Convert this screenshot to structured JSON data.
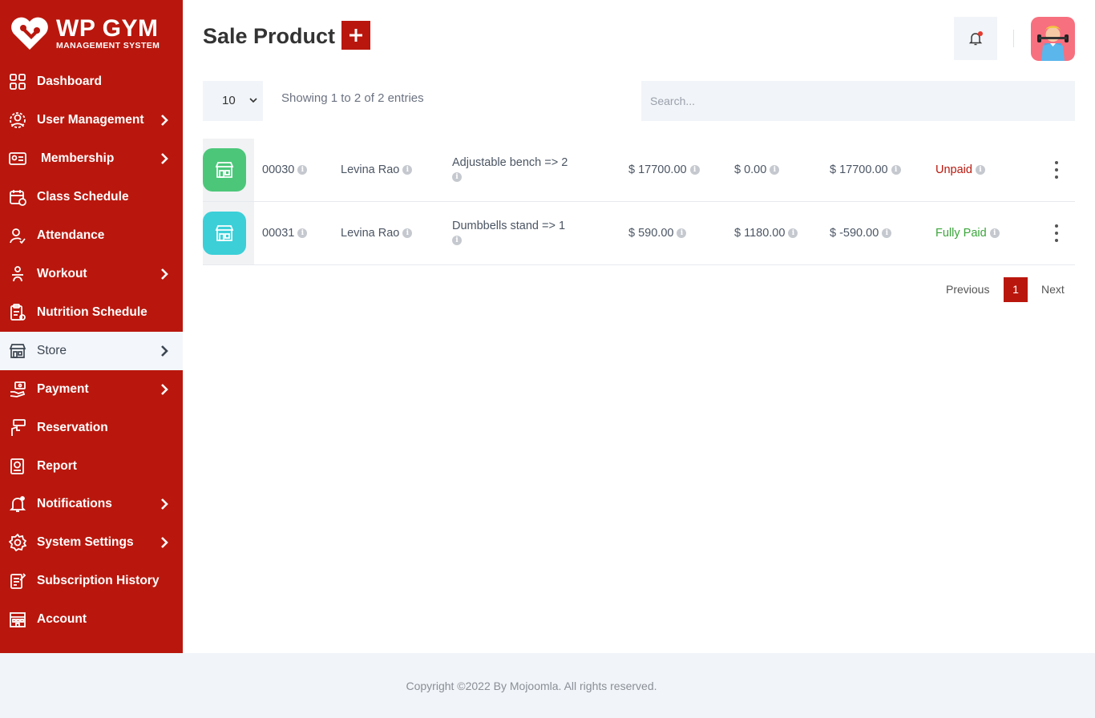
{
  "brand": {
    "title": "WP GYM",
    "subtitle": "MANAGEMENT SYSTEM"
  },
  "colors": {
    "primary": "#b9170d",
    "active_bg": "#f3f6fa",
    "unpaid": "#b9170d",
    "paid": "#3aa53a",
    "thumb_green": "#4cc77a",
    "thumb_teal": "#3ccfd8"
  },
  "sidebar": {
    "items": [
      {
        "label": "Dashboard",
        "icon": "dashboard-grid-icon",
        "has_chevron": false
      },
      {
        "label": "User Management",
        "icon": "users-gear-icon",
        "has_chevron": true
      },
      {
        "label": "Membership",
        "icon": "membership-card-icon",
        "has_chevron": true
      },
      {
        "label": "Class Schedule",
        "icon": "calendar-icon",
        "has_chevron": false
      },
      {
        "label": "Attendance",
        "icon": "user-check-icon",
        "has_chevron": false
      },
      {
        "label": "Workout",
        "icon": "workout-icon",
        "has_chevron": true
      },
      {
        "label": "Nutrition Schedule",
        "icon": "clipboard-icon",
        "has_chevron": false
      },
      {
        "label": "Store",
        "icon": "store-icon",
        "has_chevron": true,
        "active": true
      },
      {
        "label": "Payment",
        "icon": "payment-hand-icon",
        "has_chevron": true
      },
      {
        "label": "Reservation",
        "icon": "reservation-book-icon",
        "has_chevron": false
      },
      {
        "label": "Report",
        "icon": "report-icon",
        "has_chevron": false
      },
      {
        "label": "Notifications",
        "icon": "bell-icon",
        "has_chevron": true
      },
      {
        "label": "System Settings",
        "icon": "gear-icon",
        "has_chevron": true
      },
      {
        "label": "Subscription History",
        "icon": "history-doc-icon",
        "has_chevron": false
      },
      {
        "label": "Account",
        "icon": "account-building-icon",
        "has_chevron": false
      }
    ]
  },
  "header": {
    "title": "Sale Product",
    "add_label": "+"
  },
  "table": {
    "length_value": "10",
    "showing": "Showing 1 to 2 of 2 entries",
    "search_placeholder": "Search...",
    "rows": [
      {
        "id": "00030",
        "member": "Levina Rao",
        "product": "Adjustable bench => 2",
        "amount": "$ 17700.00",
        "paid": "$ 0.00",
        "due": "$ 17700.00",
        "status": "Unpaid"
      },
      {
        "id": "00031",
        "member": "Levina Rao",
        "product": "Dumbbells stand => 1",
        "amount": "$ 590.00",
        "paid": "$ 1180.00",
        "due": "$ -590.00",
        "status": "Fully Paid"
      }
    ]
  },
  "pagination": {
    "previous": "Previous",
    "current": "1",
    "next": "Next"
  },
  "footer": {
    "text": "Copyright ©2022 By Mojoomla. All rights reserved."
  }
}
